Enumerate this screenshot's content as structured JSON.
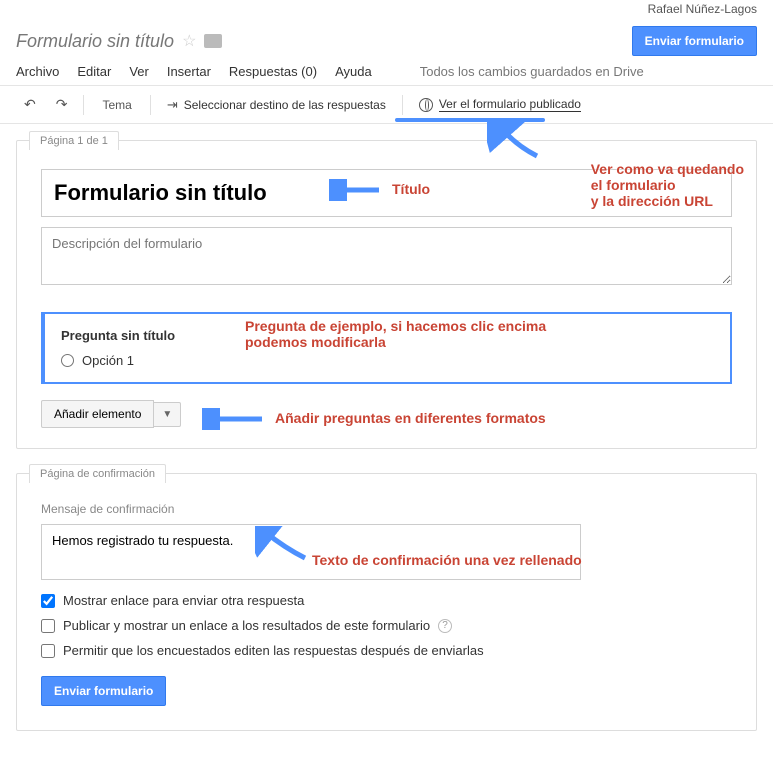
{
  "user": {
    "name": "Rafael Núñez-Lagos"
  },
  "doc": {
    "title": "Formulario sin título"
  },
  "menu": {
    "archivo": "Archivo",
    "editar": "Editar",
    "ver": "Ver",
    "insertar": "Insertar",
    "respuestas": "Respuestas (0)",
    "ayuda": "Ayuda",
    "save_status": "Todos los cambios guardados en Drive",
    "send_btn": "Enviar formulario"
  },
  "toolbar": {
    "tema": "Tema",
    "destino": "Seleccionar destino de las respuestas",
    "ver_publicado": "Ver el formulario publicado"
  },
  "page1": {
    "tab": "Página 1 de 1",
    "title_value": "Formulario sin título",
    "desc_placeholder": "Descripción del formulario",
    "question": {
      "title": "Pregunta sin título",
      "option1": "Opción 1"
    },
    "add_element": "Añadir elemento"
  },
  "confirm": {
    "tab": "Página de confirmación",
    "label": "Mensaje de confirmación",
    "value": "Hemos registrado tu respuesta.",
    "chk1": "Mostrar enlace para enviar otra respuesta",
    "chk2": "Publicar y mostrar un enlace a los resultados de este formulario",
    "chk3": "Permitir que los encuestados editen las respuestas después de enviarlas",
    "send_btn": "Enviar formulario"
  },
  "annotations": {
    "titulo": "Título",
    "ver_quedando": "Ver como va quedando\nel formulario\ny la dirección URL",
    "pregunta": "Pregunta de ejemplo, si hacemos clic encima\npodemos modificarla",
    "anadir": "Añadir preguntas en diferentes formatos",
    "confirmacion": "Texto de confirmación una vez rellenado"
  }
}
